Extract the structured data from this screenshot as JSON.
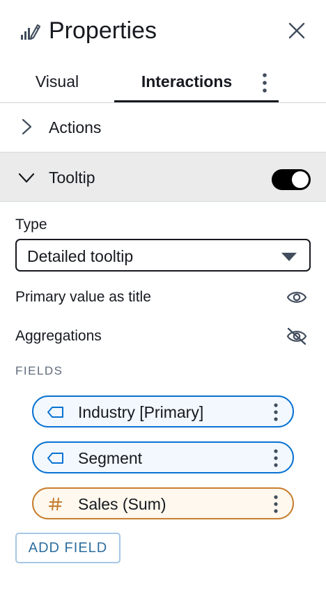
{
  "header": {
    "title": "Properties",
    "icon": "chart-pencil-icon",
    "close_icon": "close-icon"
  },
  "tabs": [
    {
      "label": "Visual",
      "active": false
    },
    {
      "label": "Interactions",
      "active": true
    }
  ],
  "sections": {
    "actions": {
      "label": "Actions",
      "expanded": false
    },
    "tooltip": {
      "label": "Tooltip",
      "expanded": true,
      "enabled": true
    }
  },
  "tooltip_settings": {
    "type_label": "Type",
    "type_value": "Detailed tooltip",
    "primary_value_label": "Primary value as title",
    "primary_value_visible": true,
    "aggregations_label": "Aggregations",
    "aggregations_visible": false,
    "fields_title": "FIELDS",
    "fields": [
      {
        "label": "Industry [Primary]",
        "kind": "dimension"
      },
      {
        "label": "Segment",
        "kind": "dimension"
      },
      {
        "label": "Sales (Sum)",
        "kind": "measure"
      }
    ],
    "add_field_label": "ADD FIELD"
  },
  "colors": {
    "dimension": "#0972d3",
    "measure": "#c77e2e",
    "text": "#16191f"
  }
}
